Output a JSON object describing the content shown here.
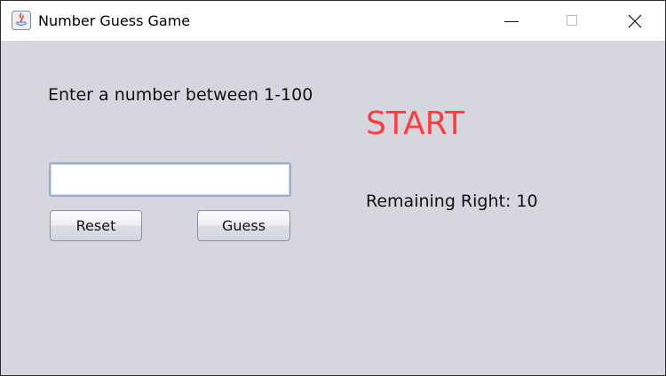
{
  "window": {
    "title": "Number Guess Game"
  },
  "game": {
    "prompt": "Enter a number between 1-100",
    "input_value": "",
    "input_placeholder": "",
    "reset_label": "Reset",
    "guess_label": "Guess",
    "status_text": "START",
    "remaining_label": "Remaining Right:",
    "remaining_value": "10"
  },
  "icons": {
    "app": "java-app-icon",
    "minimize": "minimize-icon",
    "maximize": "maximize-icon",
    "close": "close-icon"
  },
  "colors": {
    "status": "#ff3b3b",
    "background": "#d6d7de",
    "input_border": "#8fb1d6"
  }
}
